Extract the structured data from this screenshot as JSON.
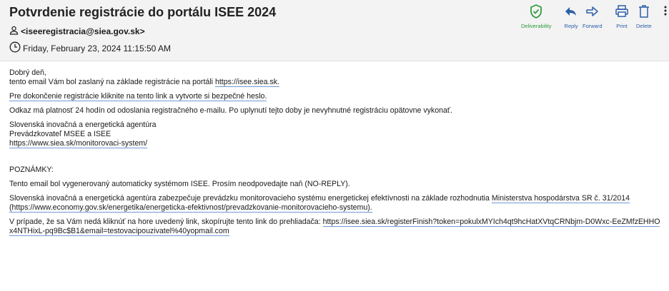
{
  "email": {
    "subject": "Potvrdenie registrácie do portálu ISEE 2024",
    "from": "<iseeregistracia@siea.gov.sk>",
    "date": "Friday, February 23, 2024 11:15:50 AM"
  },
  "toolbar": {
    "deliverability": "Deliverability",
    "reply": "Reply",
    "forward": "Forward",
    "print": "Print",
    "delete": "Delete"
  },
  "colors": {
    "deliverability": "#2e9a3a",
    "toolbar_icons": "#2b5fa8",
    "header_bg": "#f3f3f3"
  },
  "icons": [
    "person-icon",
    "clock-icon",
    "shield-check-icon",
    "reply-icon",
    "forward-icon",
    "print-icon",
    "trash-icon",
    "more-icon"
  ],
  "body": {
    "greeting": "Dobrý deň,",
    "line1_prefix": "tento email Vám bol zaslaný na základe registrácie na portáli ",
    "line1_link": "https://isee.siea.sk.",
    "line2_link": "Pre dokončenie registrácie kliknite na tento link a vytvorte si bezpečné heslo.",
    "line3": "Odkaz má platnosť 24 hodín od odoslania registračného e-mailu. Po uplynutí tejto doby je nevyhnutné registráciu opätovne vykonať.",
    "sig_org": "Slovenská inovačná a energetická agentúra",
    "sig_role": "Prevádzkovateľ MSEE a ISEE",
    "sig_link": "https://www.siea.sk/monitorovaci-system/",
    "notes_heading": "POZNÁMKY:",
    "note1": "Tento email bol vygenerovaný automaticky systémom ISEE. Prosím neodpovedajte naň (NO-REPLY).",
    "note2_prefix": "Slovenská inovačná a energetická agentúra zabezpečuje prevádzku monitorovacieho systému energetickej efektívnosti na základe rozhodnutia ",
    "note2_link": "Ministerstva hospodárstva SR č. 31/2014 (https://www.economy.gov.sk/energetika/energeticka-efektivnost/prevadzkovanie-monitorovacieho-systemu).",
    "note3_prefix": "V prípade, že sa Vám nedá kliknúť na hore uvedený link, skopírujte tento link do prehliadača: ",
    "note3_link": "https://isee.siea.sk/registerFinish?token=pokulxMYIch4qt9hcHatXVtqCRNbjm-D0Wxc-EeZMfzEHHOx4NTHixL-pq9Bc$B1&email=testovacipouzivatel%40yopmail.com"
  }
}
